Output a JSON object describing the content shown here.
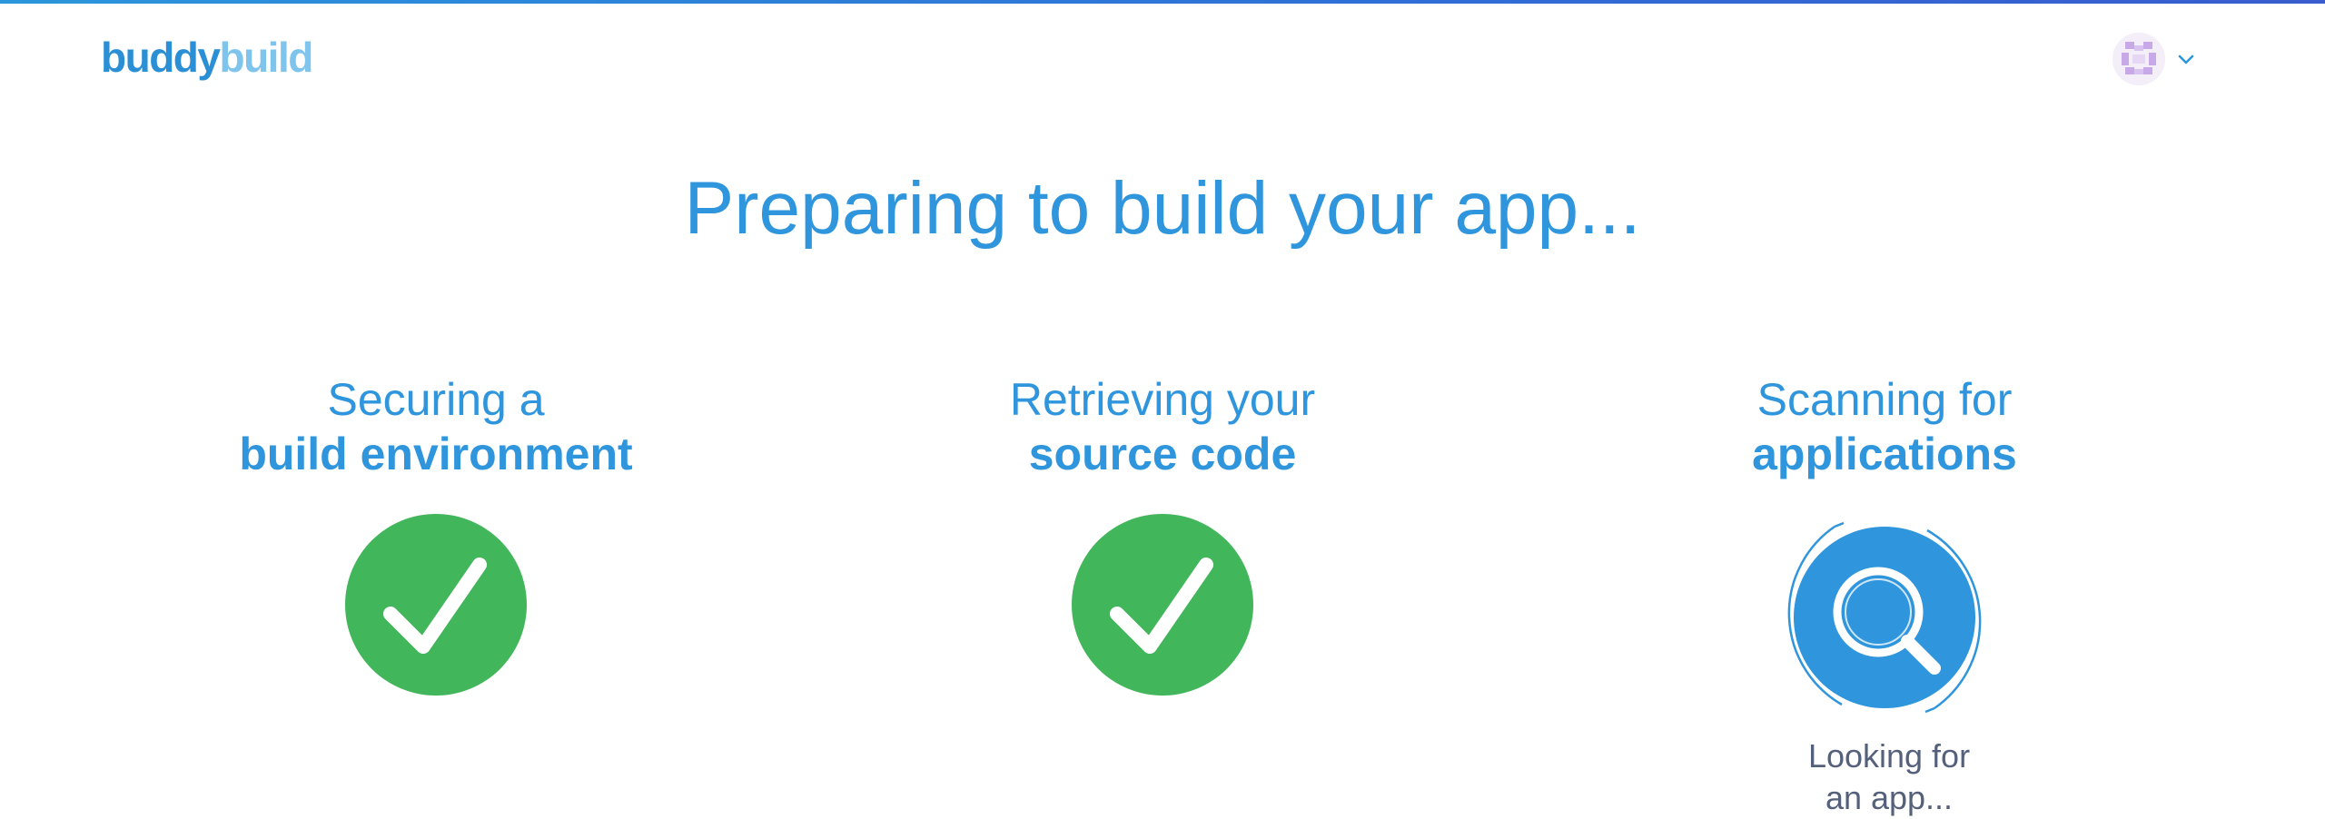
{
  "header": {
    "logo_part1": "buddy",
    "logo_part2": "build"
  },
  "page": {
    "title": "Preparing to build your app..."
  },
  "steps": [
    {
      "line1": "Securing a",
      "line2": "build environment",
      "state": "complete",
      "icon": "check-icon"
    },
    {
      "line1": "Retrieving your",
      "line2": "source code",
      "state": "complete",
      "icon": "check-icon"
    },
    {
      "line1": "Scanning for",
      "line2": "applications",
      "state": "in-progress",
      "icon": "magnifier-icon",
      "status_line1": "Looking for",
      "status_line2": "an app..."
    }
  ],
  "colors": {
    "accent": "#2f95dc",
    "success": "#42b65a",
    "status_text": "#55607a"
  }
}
